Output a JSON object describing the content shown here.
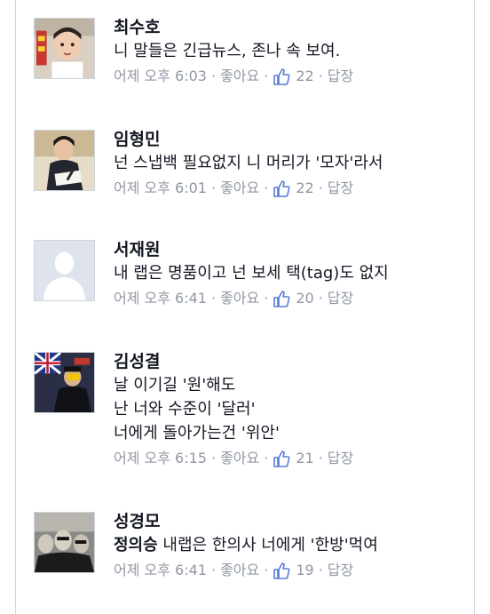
{
  "comments": [
    {
      "author": "최수호",
      "lines": [
        "니 말들은 긴급뉴스, 존나 속 보여."
      ],
      "mention": "",
      "time": "어제 오후 6:03",
      "like_label": "좋아요",
      "like_count": "22",
      "reply_label": "답장",
      "avatar": "child-photo"
    },
    {
      "author": "임형민",
      "lines": [
        "넌 스냅백 필요없지 니 머리가 '모자'라서"
      ],
      "mention": "",
      "time": "어제 오후 6:01",
      "like_label": "좋아요",
      "like_count": "22",
      "reply_label": "답장",
      "avatar": "man-writing-photo"
    },
    {
      "author": "서재원",
      "lines": [
        "내 랩은 명품이고 넌 보세 택(tag)도 없지"
      ],
      "mention": "",
      "time": "어제 오후 6:41",
      "like_label": "좋아요",
      "like_count": "20",
      "reply_label": "답장",
      "avatar": "default-silhouette"
    },
    {
      "author": "김성결",
      "lines": [
        "날 이기길 '원'해도",
        "난 너와 수준이 '달러'",
        "너에게 돌아가는건 '위안'"
      ],
      "mention": "",
      "time": "어제 오후 6:15",
      "like_label": "좋아요",
      "like_count": "21",
      "reply_label": "답장",
      "avatar": "flag-photo"
    },
    {
      "author": "성경모",
      "lines": [
        "내랩은 한의사 너에게 '한방'먹여"
      ],
      "mention": "정의승",
      "time": "어제 오후 6:41",
      "like_label": "좋아요",
      "like_count": "19",
      "reply_label": "답장",
      "avatar": "group-photo"
    }
  ],
  "icons": {
    "like": "thumbs-up-icon"
  },
  "colors": {
    "meta_text": "#9197a3",
    "like_icon": "#5b7bd5",
    "name_text": "#141823"
  }
}
